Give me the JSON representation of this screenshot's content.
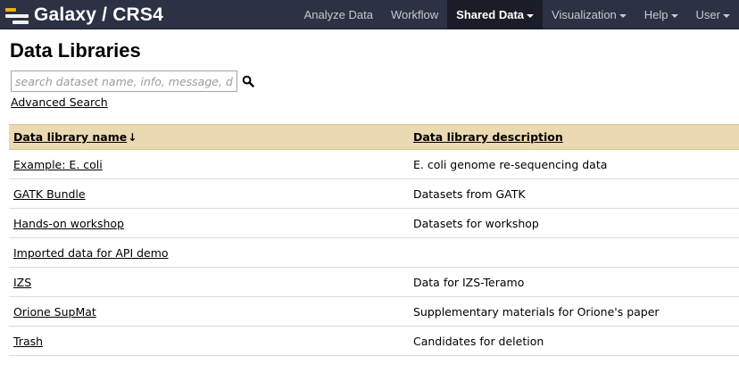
{
  "brand": {
    "title": "Galaxy / CRS4"
  },
  "nav": {
    "tabs": [
      {
        "label": "Analyze Data",
        "dropdown": false,
        "active": false
      },
      {
        "label": "Workflow",
        "dropdown": false,
        "active": false
      },
      {
        "label": "Shared Data",
        "dropdown": true,
        "active": true
      },
      {
        "label": "Visualization",
        "dropdown": true,
        "active": false
      },
      {
        "label": "Help",
        "dropdown": true,
        "active": false
      },
      {
        "label": "User",
        "dropdown": true,
        "active": false
      }
    ]
  },
  "page": {
    "title": "Data Libraries"
  },
  "search": {
    "placeholder": "search dataset name, info, message, dbkey",
    "value": "",
    "icon": "search-icon",
    "advanced_label": "Advanced Search"
  },
  "table": {
    "columns": {
      "name": "Data library name",
      "name_sort_indicator": "↓",
      "description": "Data library description"
    },
    "rows": [
      {
        "name": "Example: E. coli",
        "description": "E. coli genome re-sequencing data"
      },
      {
        "name": "GATK Bundle",
        "description": "Datasets from GATK"
      },
      {
        "name": "Hands-on workshop",
        "description": "Datasets for workshop"
      },
      {
        "name": "Imported data for API demo",
        "description": ""
      },
      {
        "name": "IZS",
        "description": "Data for IZS-Teramo"
      },
      {
        "name": "Orione SupMat",
        "description": "Supplementary materials for Orione's paper"
      },
      {
        "name": "Trash",
        "description": "Candidates for deletion"
      }
    ]
  },
  "colors": {
    "masthead": "#2c3143",
    "active_tab": "#1a1d28",
    "table_header": "#ebd9b2",
    "logo_accent": "#eab20f"
  }
}
